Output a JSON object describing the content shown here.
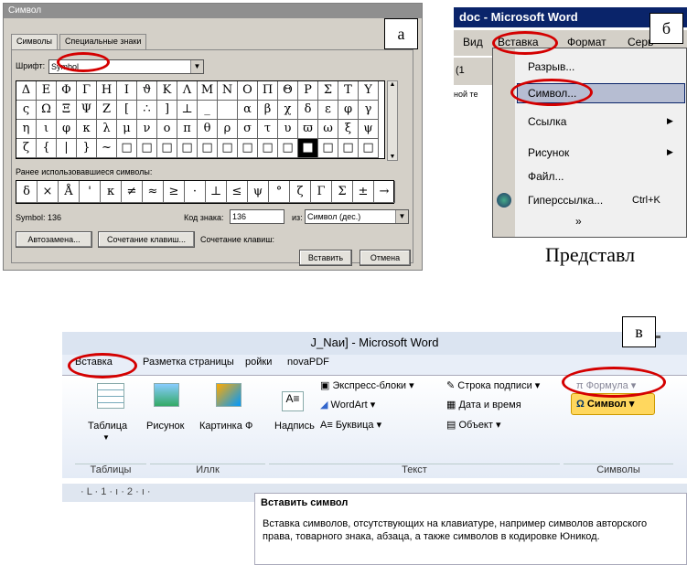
{
  "labels": {
    "a": "а",
    "b": "б",
    "c": "в"
  },
  "dialog": {
    "title": "Символ",
    "tab_symbols": "Символы",
    "tab_special": "Специальные знаки",
    "font_label": "Шрифт:",
    "font_value": "Symbol",
    "rows": [
      [
        "Δ",
        "Ε",
        "Φ",
        "Γ",
        "Η",
        "Ι",
        "ϑ",
        "Κ",
        "Λ",
        "Μ",
        "Ν",
        "Ο",
        "Π",
        "Θ",
        "Ρ",
        "Σ",
        "Τ",
        "Υ"
      ],
      [
        "ς",
        "Ω",
        "Ξ",
        "Ψ",
        "Ζ",
        "[",
        "∴",
        "]",
        "⊥",
        "_",
        "",
        "α",
        "β",
        "χ",
        "δ",
        "ε",
        "φ",
        "γ"
      ],
      [
        "η",
        "ι",
        "φ",
        "κ",
        "λ",
        "μ",
        "ν",
        "ο",
        "π",
        "θ",
        "ρ",
        "σ",
        "τ",
        "υ",
        "ϖ",
        "ω",
        "ξ",
        "ψ"
      ],
      [
        "ζ",
        "{",
        "|",
        "}",
        "~",
        "□",
        "□",
        "□",
        "□",
        "□",
        "□",
        "□",
        "□",
        "□",
        "■",
        "□",
        "□",
        "□"
      ]
    ],
    "recent_label": "Ранее использовавшиеся символы:",
    "recent": [
      "δ",
      "×",
      "Å",
      "'",
      "κ",
      "≠",
      "≈",
      "≥",
      "·",
      "⊥",
      "≤",
      "ψ",
      "°",
      "ζ",
      "Γ",
      "Σ",
      "±",
      "→"
    ],
    "symbol_info": "Symbol: 136",
    "code_label": "Код знака:",
    "code_value": "136",
    "from_label": "из:",
    "from_value": "Символ (дес.)",
    "autocorrect": "Автозамена...",
    "shortcut_btn": "Сочетание клавиш...",
    "shortcut_label": "Сочетание клавиш:",
    "insert": "Вставить",
    "cancel": "Отмена"
  },
  "word2003": {
    "title": "doc - Microsoft Word",
    "menu_view": "Вид",
    "menu_insert": "Вставка",
    "menu_format": "Формат",
    "menu_service": "Серв",
    "toolbar_text": "(1",
    "side_text": "ной те",
    "items": [
      "Разрыв...",
      "Символ...",
      "Ссылка",
      "Рисунок",
      "Файл...",
      "Гиперссылка...",
      "Ctrl+K"
    ],
    "more": "»",
    "bg_text": "Представл"
  },
  "word2007": {
    "title": "J_Naи] - Microsoft Word",
    "tab_insert": "Вставка",
    "tab_layout": "Разметка страницы",
    "tab_refs": "ройки",
    "tab_pdf": "novaPDF",
    "table": "Таблица",
    "picture": "Рисунок",
    "clipart": "Картинка",
    "clipart_cut": "Ф",
    "textbox": "Надпись",
    "express": "Экспресс-блоки",
    "wordart": "WordArt",
    "dropcap": "Буквица",
    "sigline": "Строка подписи",
    "datetime": "Дата и время",
    "object": "Объект",
    "formula": "Формула",
    "symbol": "Символ",
    "grp_tables": "Таблицы",
    "grp_illus": "Иллк",
    "grp_text": "Текст",
    "grp_symbols": "Символы",
    "ruler": "· L · 1 · ı · 2 · ı ·",
    "tip_title": "Вставить символ",
    "tip_body": "Вставка символов, отсутствующих на клавиатуре, например символов авторского права, товарного знака, абзаца, а также символов в кодировке Юникод."
  }
}
